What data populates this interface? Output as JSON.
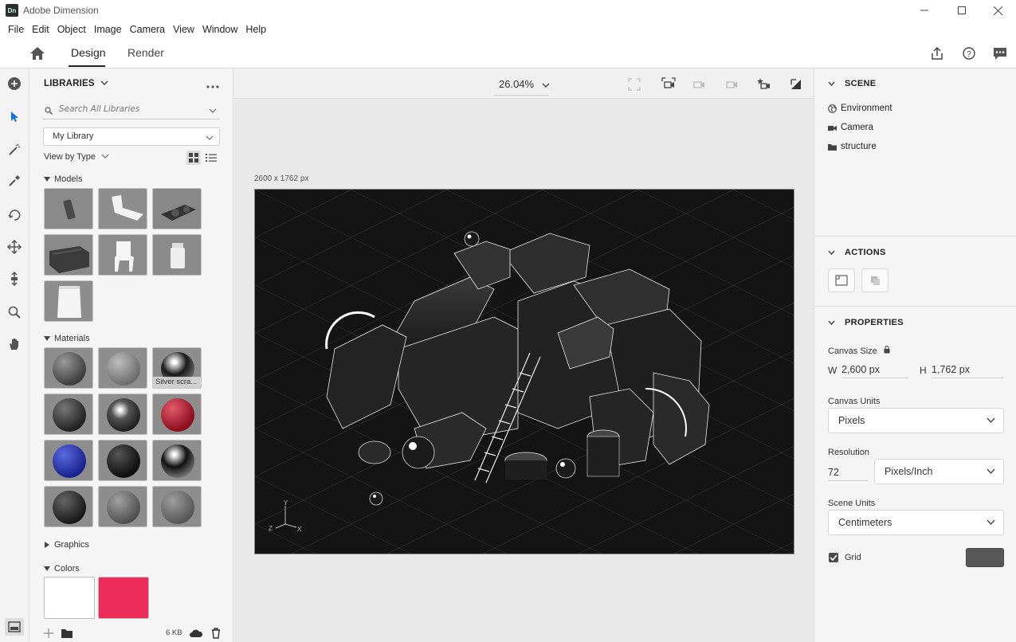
{
  "app": {
    "badge": "Dn",
    "title": "Adobe Dimension"
  },
  "menu": [
    "File",
    "Edit",
    "Object",
    "Image",
    "Camera",
    "View",
    "Window",
    "Help"
  ],
  "modes": {
    "design": "Design",
    "render": "Render"
  },
  "libraries": {
    "header": "LIBRARIES",
    "search_placeholder": "Search All Libraries",
    "library_select": "My Library",
    "view_by": "View by Type",
    "sections": {
      "models": "Models",
      "materials": "Materials",
      "graphics": "Graphics",
      "colors": "Colors"
    },
    "material_tooltip": "Silver scra...",
    "footer_size": "6 KB",
    "colors": [
      "#ffffff",
      "#ec2d5c"
    ]
  },
  "canvas": {
    "zoom": "26.04%",
    "doc_size": "2600 x 1762 px",
    "axes": {
      "y": "Y",
      "x": "X",
      "z": "Z"
    }
  },
  "scene": {
    "header": "SCENE",
    "items": [
      {
        "label": "Environment",
        "icon": "globe-icon"
      },
      {
        "label": "Camera",
        "icon": "camera-icon"
      },
      {
        "label": "structure",
        "icon": "folder-icon"
      }
    ]
  },
  "actions": {
    "header": "ACTIONS"
  },
  "properties": {
    "header": "PROPERTIES",
    "canvas_size_label": "Canvas Size",
    "width_label": "W",
    "width_value": "2,600 px",
    "height_label": "H",
    "height_value": "1,762 px",
    "canvas_units_label": "Canvas Units",
    "canvas_units_value": "Pixels",
    "resolution_label": "Resolution",
    "resolution_value": "72",
    "resolution_unit": "Pixels/Inch",
    "scene_units_label": "Scene Units",
    "scene_units_value": "Centimeters",
    "grid_label": "Grid",
    "grid_checked": true,
    "grid_color": "#585858"
  }
}
